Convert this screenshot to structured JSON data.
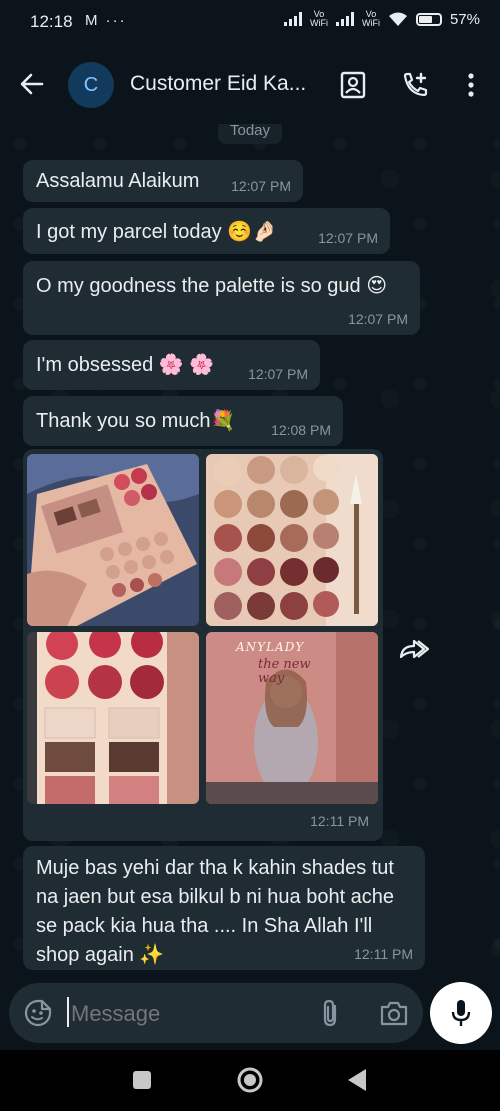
{
  "status_bar": {
    "time": "12:18",
    "left_icons": "M ···",
    "vo_wifi_1": "Vo\nWiFi",
    "vo_wifi_2": "Vo\nWiFi",
    "battery": "57%",
    "battery_level": 0.57
  },
  "header": {
    "avatar_letter": "C",
    "contact_name": "Customer Eid Ka..."
  },
  "chat": {
    "day_label": "Today",
    "messages": [
      {
        "text": "Assalamu Alaikum",
        "time": "12:07 PM"
      },
      {
        "text": "I got my parcel today ☺️🤌🏻",
        "time": "12:07 PM"
      },
      {
        "text": "O my goodness the palette is so gud 😍",
        "time": "12:07 PM"
      },
      {
        "text": "I'm obsessed 🌸 🌸",
        "time": "12:07 PM"
      },
      {
        "text": "Thank you so much💐",
        "time": "12:08 PM"
      },
      {
        "text": "",
        "time": "12:11 PM"
      },
      {
        "text": "Muje bas yehi dar tha k kahin shades tut na jaen but esa bilkul b ni hua boht ache se pack kia hua tha .... In Sha Allah I'll shop again ✨",
        "time": "12:11 PM"
      }
    ],
    "photo_text": {
      "brand": "ANYLADY",
      "tagline": "the new way"
    }
  },
  "composer": {
    "placeholder": "Message"
  },
  "colors": {
    "background": "#0b141a",
    "bubble": "#202c33",
    "text": "#e9edef",
    "meta": "#8696a0"
  }
}
